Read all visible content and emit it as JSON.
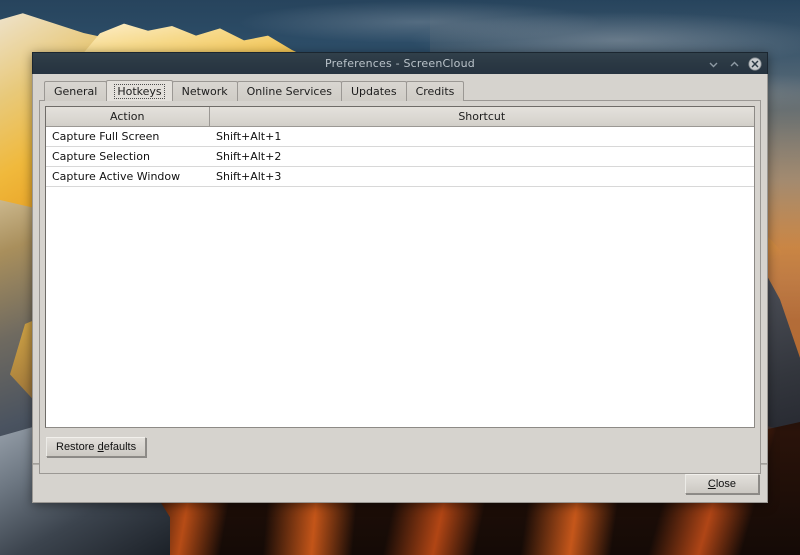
{
  "window": {
    "title": "Preferences - ScreenCloud",
    "controls": [
      {
        "name": "minimize",
        "glyph": "minimize-icon"
      },
      {
        "name": "maximize",
        "glyph": "maximize-icon"
      },
      {
        "name": "close",
        "glyph": "close-icon"
      }
    ]
  },
  "tabs": [
    {
      "label": "General",
      "selected": false
    },
    {
      "label": "Hotkeys",
      "selected": true
    },
    {
      "label": "Network",
      "selected": false
    },
    {
      "label": "Online Services",
      "selected": false
    },
    {
      "label": "Updates",
      "selected": false
    },
    {
      "label": "Credits",
      "selected": false
    }
  ],
  "hotkeys_table": {
    "columns": [
      "Action",
      "Shortcut"
    ],
    "rows": [
      {
        "action": "Capture Full Screen",
        "shortcut": "Shift+Alt+1"
      },
      {
        "action": "Capture Selection",
        "shortcut": "Shift+Alt+2"
      },
      {
        "action": "Capture Active Window",
        "shortcut": "Shift+Alt+3"
      }
    ]
  },
  "buttons": {
    "restore_defaults": {
      "pre": "Restore ",
      "mnemonic": "d",
      "post": "efaults"
    },
    "close": {
      "pre": "",
      "mnemonic": "C",
      "post": "lose"
    }
  },
  "colors": {
    "titlebar": "#2b3944",
    "titlebar_text": "#b9c2c9",
    "window_bg": "#d6d3ce",
    "table_bg": "#ffffff",
    "header_bg": "#dbd8d2",
    "border": "#9b9894"
  }
}
